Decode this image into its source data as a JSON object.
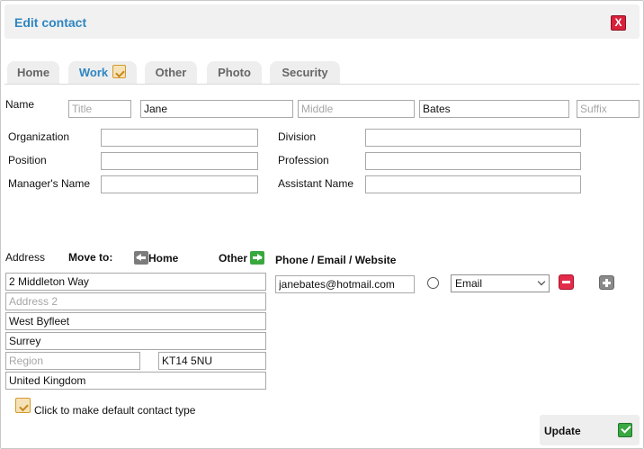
{
  "dialog": {
    "title": "Edit contact",
    "close_glyph": "X"
  },
  "tabs": [
    {
      "label": "Home",
      "active": false
    },
    {
      "label": "Work",
      "active": true,
      "icon": "default-contact-type-icon"
    },
    {
      "label": "Other",
      "active": false
    },
    {
      "label": "Photo",
      "active": false
    },
    {
      "label": "Security",
      "active": false
    }
  ],
  "name": {
    "label": "Name",
    "title": {
      "value": "",
      "placeholder": "Title"
    },
    "first": {
      "value": "Jane",
      "placeholder": ""
    },
    "middle": {
      "value": "",
      "placeholder": "Middle"
    },
    "last": {
      "value": "Bates",
      "placeholder": ""
    },
    "suffix": {
      "value": "",
      "placeholder": "Suffix"
    }
  },
  "work": {
    "organization_label": "Organization",
    "position_label": "Position",
    "manager_label": "Manager's Name",
    "division_label": "Division",
    "profession_label": "Profession",
    "assistant_label": "Assistant Name"
  },
  "address": {
    "label": "Address",
    "move_to_label": "Move to:",
    "home_label": "Home",
    "other_label": "Other",
    "street1": {
      "value": "2 Middleton Way",
      "placeholder": ""
    },
    "street2": {
      "value": "",
      "placeholder": "Address 2"
    },
    "city": {
      "value": "West Byfleet",
      "placeholder": ""
    },
    "county": {
      "value": "Surrey",
      "placeholder": ""
    },
    "region": {
      "value": "",
      "placeholder": "Region"
    },
    "postcode": {
      "value": "KT14 5NU",
      "placeholder": ""
    },
    "country": {
      "value": "United Kingdom",
      "placeholder": ""
    }
  },
  "contact": {
    "heading": "Phone / Email / Website",
    "value": "janebates@hotmail.com",
    "type_selected": "Email"
  },
  "default_note": "Click to make default contact type",
  "update_label": "Update",
  "colors": {
    "accent": "#2e86c1",
    "close": "#d9213c",
    "confirm": "#3aa843"
  }
}
